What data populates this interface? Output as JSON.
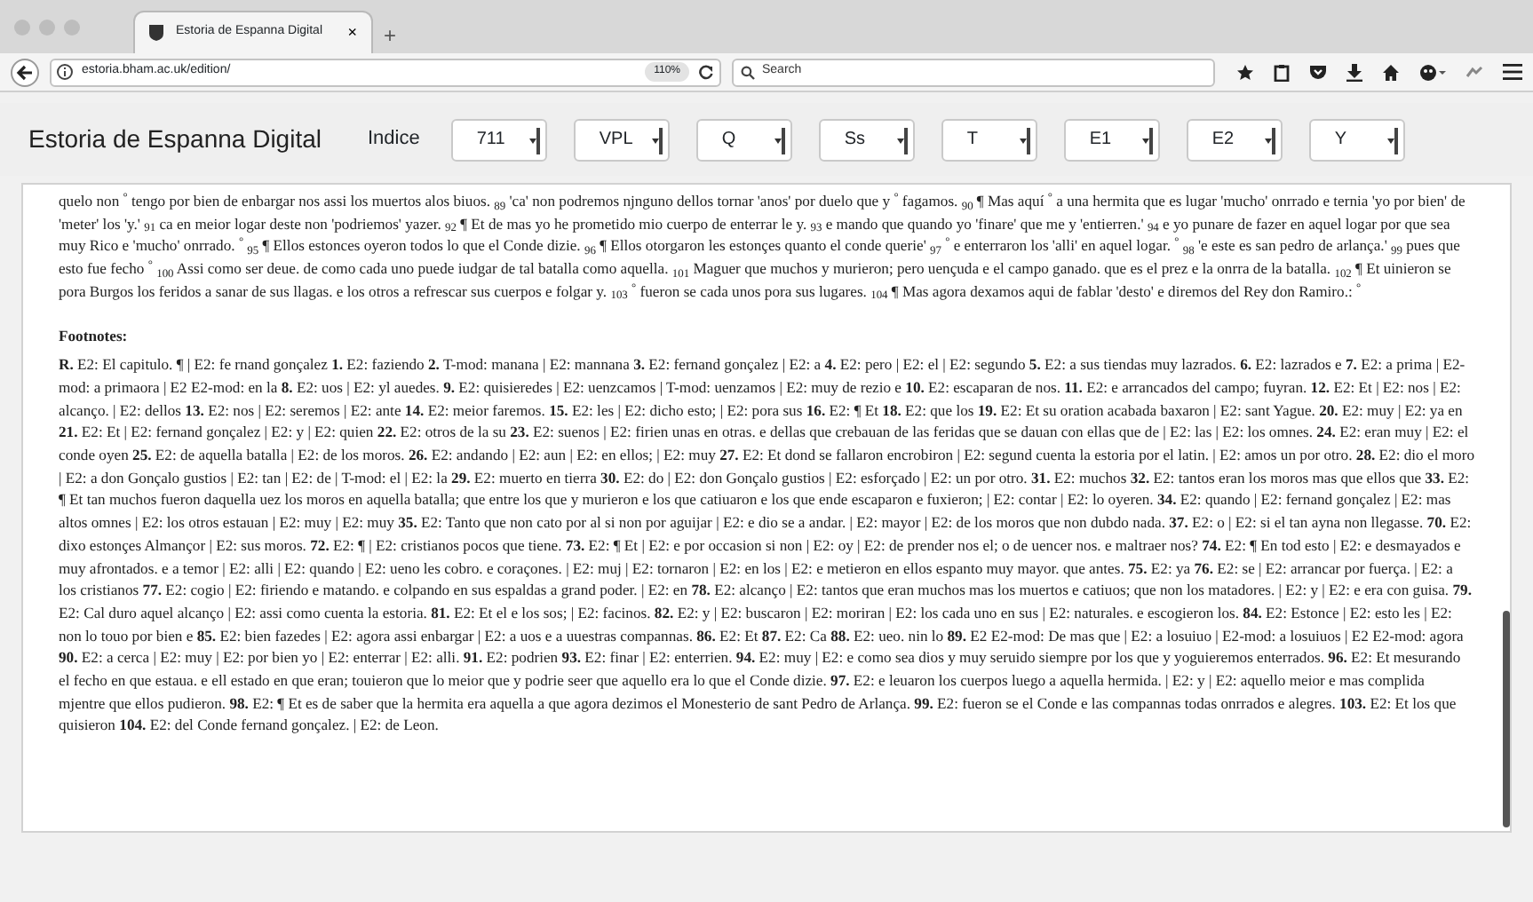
{
  "browser": {
    "tab_title": "Estoria de Espanna Digital",
    "tab_close": "×",
    "new_tab": "+",
    "url": "estoria.bham.ac.uk/edition/",
    "zoom": "110%",
    "search_placeholder": "Search"
  },
  "app": {
    "title": "Estoria de Espanna Digital",
    "index_label": "Indice",
    "selects": [
      "711",
      "VPL",
      "Q",
      "Ss",
      "T",
      "E1",
      "E2",
      "Y"
    ]
  },
  "content": {
    "paragraph": "quelo non $^{°}$ tengo por bien de enbargar nos assi los muertos alos biuos. $_{89}$ 'ca' non podremos njnguno dellos tornar 'anos' por duelo que y $^{°}$ fagamos. $_{90}$ ¶ Mas aquí $^{°}$ a una hermita que es lugar 'mucho' onrrado e ternia 'yo por bien' de 'meter' los 'y.' $_{91}$ ca en meior logar deste non 'podriemos' yazer. $_{92}$ ¶ Et de mas yo he prometido mio cuerpo de enterrar le y. $_{93}$ e mando que quando yo 'finare' que me y 'entierren.' $_{94}$ e yo punare de fazer en aquel logar por que sea muy Rico e 'mucho' onrrado. $^{°}$ $_{95}$ ¶ Ellos estonces oyeron todos lo que el Conde dizie. $_{96}$ ¶ Ellos otorgaron les estonçes quanto el conde querie' $_{97}$ $^{°}$ e enterraron los 'alli' en aquel logar. $^{°}$ $_{98}$ 'e este es san pedro de arlança.' $_{99}$ pues que esto fue fecho $^{°}$ $_{100}$ Assi como ser deue. de como cada uno puede iudgar de tal batalla como aquella. $_{101}$ Maguer que muchos y murieron; pero uençuda e el campo ganado. que es el prez e la onrra de la batalla. $_{102}$ ¶ Et uinieron se pora Burgos los feridos a sanar de sus llagas. e los otros a refrescar sus cuerpos e folgar y. $_{103}$ $^{°}$ fueron se cada unos pora sus lugares. $_{104}$ ¶ Mas agora dexamos aqui de fablar 'desto' e diremos del Rey don Ramiro.: $^{°}$",
    "footnotes_heading": "Footnotes:",
    "footnotes": "**R.** E2: El capitulo. ¶ | E2: fe rnand gonçalez **1.** E2: faziendo **2.** T-mod: manana | E2: mannana **3.** E2: fernand gonçalez | E2: a **4.** E2: pero | E2: el | E2: segundo **5.** E2: a sus tiendas muy lazrados. **6.** E2: lazrados e **7.** E2: a prima | E2-mod: a primaora | E2 E2-mod: en la **8.** E2: uos | E2: yl auedes. **9.** E2: quisieredes | E2: uenzcamos | T-mod: uenzamos | E2: muy de rezio e **10.** E2: escaparan de nos. **11.** E2: e arrancados del campo; fuyran. **12.** E2: Et | E2: nos | E2: alcanço. | E2: dellos **13.** E2: nos | E2: seremos | E2: ante **14.** E2: meior faremos. **15.** E2: les | E2: dicho esto; | E2: pora sus **16.** E2: ¶ Et **18.** E2: que los **19.** E2: Et su oration acabada baxaron | E2: sant Yague. **20.** E2: muy | E2: ya en **21.** E2: Et | E2: fernand gonçalez | E2: y | E2: quien **22.** E2: otros de la su **23.** E2: suenos | E2: firien unas en otras. e dellas que crebauan de las feridas que se dauan con ellas que de | E2: las | E2: los omnes. **24.** E2: eran muy | E2: el conde oyen **25.** E2: de aquella batalla | E2: de los moros. **26.** E2: andando | E2: aun | E2: en ellos; | E2: muy **27.** E2: Et dond se fallaron encrobiron | E2: segund cuenta la estoria por el latin. | E2: amos un por otro. **28.** E2: dio el moro | E2: a don Gonçalo gustios | E2: tan | E2: de | T-mod: el | E2: la **29.** E2: muerto en tierra **30.** E2: do | E2: don Gonçalo gustios | E2: esforçado | E2: un por otro. **31.** E2: muchos **32.** E2: tantos eran los moros mas que ellos que **33.** E2: ¶ Et tan muchos fueron daquella uez los moros en aquella batalla; que entre los que y murieron e los que catiuaron e los que ende escaparon e fuxieron; | E2: contar | E2: lo oyeren. **34.** E2: quando | E2: fernand gonçalez | E2: mas altos omnes | E2: los otros estauan | E2: muy | E2: muy **35.** E2: Tanto que non cato por al si non por aguijar | E2: e dio se a andar. | E2: mayor | E2: de los moros que non dubdo nada. **37.** E2: o | E2: si el tan ayna non llegasse. **70.** E2: dixo estonçes Almançor | E2: sus moros. **72.** E2: ¶ | E2: cristianos pocos que tiene. **73.** E2: ¶ Et | E2: e por occasion si non | E2: oy | E2: de prender nos el; o de uencer nos. e maltraer nos? **74.** E2: ¶ En tod esto | E2: e desmayados e muy afrontados. e a temor | E2: alli | E2: quando | E2: ueno les cobro. e coraçones. | E2: muj | E2: tornaron | E2: en los | E2: e metieron en ellos espanto muy mayor. que antes. **75.** E2: ya **76.** E2: se | E2: arrancar por fuerça. | E2: a los cristianos **77.** E2: cogio | E2: firiendo e matando. e colpando en sus espaldas a grand poder. | E2: en **78.** E2: alcanço | E2: tantos que eran muchos mas los muertos e catiuos; que non los matadores. | E2: y | E2: e era con guisa. **79.** E2: Cal duro aquel alcanço | E2: assi como cuenta la estoria. **81.** E2: Et el e los sos; | E2: facinos. **82.** E2: y | E2: buscaron | E2: moriran | E2: los cada uno en sus | E2: naturales. e escogieron los. **84.** E2: Estonce | E2: esto les | E2: non lo touo por bien e **85.** E2: bien fazedes | E2: agora assi enbargar | E2: a uos e a uuestras compannas. **86.** E2: Et **87.** E2: Ca **88.** E2: ueo. nin lo **89.** E2 E2-mod: De mas que | E2: a losuiuo | E2-mod: a losuiuos | E2 E2-mod: agora **90.** E2: a cerca | E2: muy | E2: por bien yo | E2: enterrar | E2: alli. **91.** E2: podrien **93.** E2: finar | E2: enterrien. **94.** E2: muy | E2: e como sea dios y muy seruido siempre por los que y yoguieremos enterrados. **96.** E2: Et mesurando el fecho en que estaua. e ell estado en que eran; touieron que lo meior que y podrie seer que aquello era lo que el Conde dizie. **97.** E2: e leuaron los cuerpos luego a aquella hermida. | E2: y | E2: aquello meior e mas complida mjentre que ellos pudieron. **98.** E2: ¶ Et es de saber que la hermita era aquella a que agora dezimos el Monesterio de sant Pedro de Arlança. **99.** E2: fueron se el Conde e las compannas todas onrrados e alegres. **103.** E2: Et los que quisieron **104.** E2: del Conde fernand gonçalez. | E2: de Leon."
  }
}
